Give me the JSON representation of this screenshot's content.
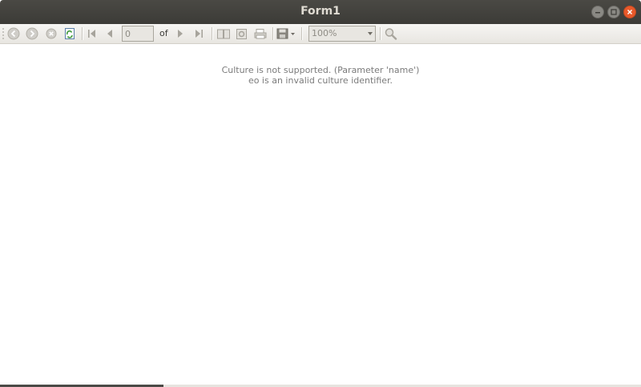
{
  "window": {
    "title": "Form1"
  },
  "toolbar": {
    "page_value": "0",
    "of_label": "of",
    "zoom_value": "100%",
    "icons": [
      "back-icon",
      "forward-icon",
      "stop-icon",
      "refresh-icon",
      "first-page-icon",
      "previous-page-icon",
      "next-page-icon",
      "last-page-icon",
      "print-layout-icon",
      "page-setup-icon",
      "print-icon",
      "export-icon",
      "find-icon"
    ]
  },
  "content": {
    "message_line1": "Culture is not supported. (Parameter 'name')",
    "message_line2": "eo is an invalid culture identifier."
  },
  "colors": {
    "titlebar": "#3c3b37",
    "close_button": "#e9592a",
    "message_text": "#7b7b7b"
  }
}
